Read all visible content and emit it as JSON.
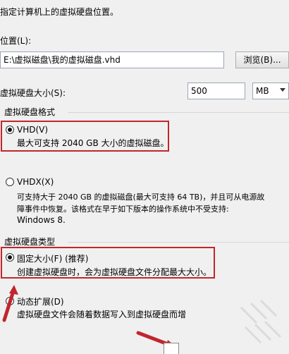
{
  "dialog": {
    "intro": "指定计算机上的虚拟硬盘位置。",
    "location_label": "位置(L):",
    "location_value": "E:\\虚拟磁盘\\我的虚拟磁盘.vhd",
    "browse_button": "浏览(B)...",
    "size_label": "虚拟硬盘大小(S):",
    "size_value": "500",
    "size_unit": "MB"
  },
  "format_group": {
    "title": "虚拟硬盘格式",
    "options": [
      {
        "label": "VHD(V)",
        "description": "最大可支持 2040 GB 大小的虚拟磁盘。",
        "selected": true
      },
      {
        "label": "VHDX(X)",
        "description_lines": [
          "可支持大于 2040 GB 的虚拟磁盘(最大可支持 64 TB)，并且可从电源故",
          "障事件中恢复。该格式在早于如下版本的操作系统中不受支持:",
          "Windows 8."
        ],
        "selected": false
      }
    ]
  },
  "type_group": {
    "title": "虚拟硬盘类型",
    "options": [
      {
        "label": "固定大小(F) (推荐)",
        "description": "创建虚拟硬盘时，会为虚拟硬盘文件分配最大大小。",
        "selected": true
      },
      {
        "label": "动态扩展(D)",
        "description": "虚拟硬盘文件会随着数据写入到虚拟硬盘而增",
        "selected": false
      }
    ]
  },
  "colors": {
    "highlight": "#c0262d",
    "background": "#f0f0f0"
  }
}
